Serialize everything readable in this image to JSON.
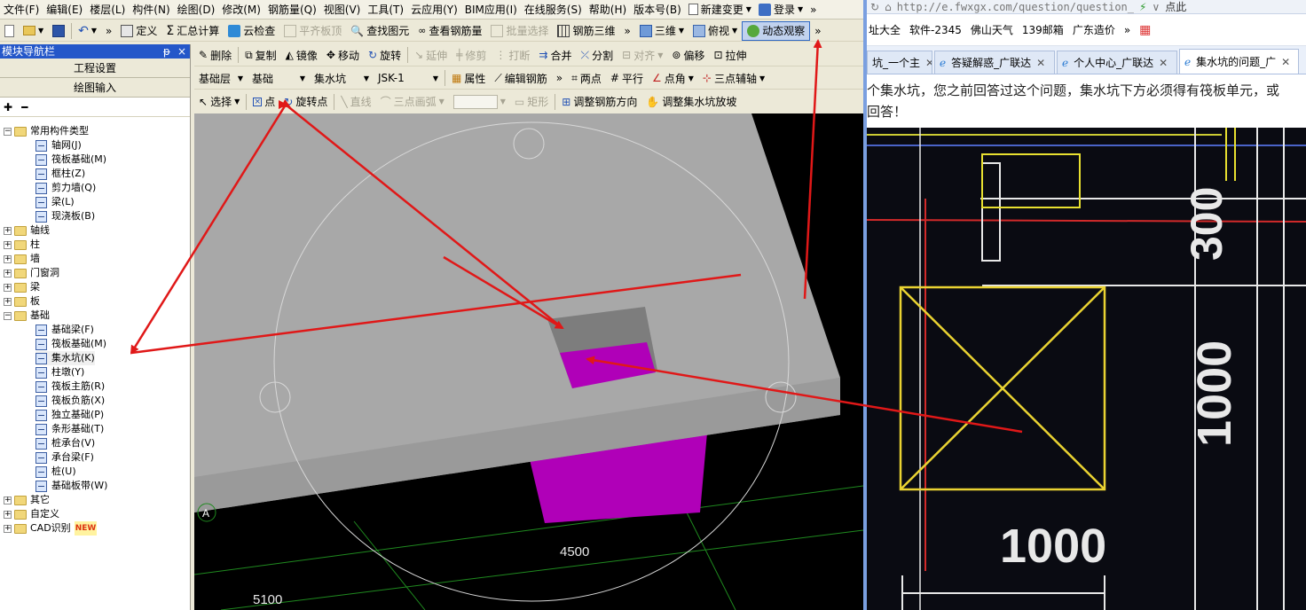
{
  "menu": {
    "items": [
      "文件(F)",
      "编辑(E)",
      "楼层(L)",
      "构件(N)",
      "绘图(D)",
      "修改(M)",
      "钢筋量(Q)",
      "视图(V)",
      "工具(T)",
      "云应用(Y)",
      "BIM应用(I)",
      "在线服务(S)",
      "帮助(H)",
      "版本号(B)"
    ],
    "new_change": "新建变更",
    "login": "登录"
  },
  "toolbar1": {
    "define": "定义",
    "sum": "汇总计算",
    "cloud_check": "云检查",
    "flat_top": "平齐板顶",
    "find": "查找图元",
    "view_rebar": "查看钢筋量",
    "batch_select": "批量选择",
    "rebar_3d": "钢筋三维",
    "view_3d": "三维",
    "top_view": "俯视",
    "dynamic": "动态观察"
  },
  "toolbar2": {
    "delete": "删除",
    "copy": "复制",
    "mirror": "镜像",
    "move": "移动",
    "rotate": "旋转",
    "extend": "延伸",
    "trim": "修剪",
    "break": "打断",
    "merge": "合并",
    "split": "分割",
    "align": "对齐",
    "offset": "偏移",
    "stretch": "拉伸"
  },
  "toolbar3": {
    "layer": "基础层",
    "category": "基础",
    "component_type": "集水坑",
    "component": "JSK-1",
    "property": "属性",
    "edit_rebar": "编辑钢筋",
    "two_points": "两点",
    "parallel": "平行",
    "point_angle": "点角",
    "three_point_aux": "三点辅轴"
  },
  "toolbar4": {
    "select": "选择",
    "point": "点",
    "rotate_point": "旋转点",
    "line": "直线",
    "three_point_arc": "三点画弧",
    "rect": "矩形",
    "adjust_rebar_dir": "调整钢筋方向",
    "adjust_pit_slope": "调整集水坑放坡"
  },
  "nav": {
    "title": "模块导航栏",
    "pin": "ᵽ",
    "close": "×",
    "project_settings": "工程设置",
    "draw_input": "绘图输入",
    "tree": [
      {
        "label": "常用构件类型",
        "type": "folder",
        "expanded": true
      },
      {
        "label": "轴网(J)",
        "type": "leaf"
      },
      {
        "label": "筏板基础(M)",
        "type": "leaf"
      },
      {
        "label": "框柱(Z)",
        "type": "leaf"
      },
      {
        "label": "剪力墙(Q)",
        "type": "leaf"
      },
      {
        "label": "梁(L)",
        "type": "leaf"
      },
      {
        "label": "现浇板(B)",
        "type": "leaf"
      },
      {
        "label": "轴线",
        "type": "folder"
      },
      {
        "label": "柱",
        "type": "folder"
      },
      {
        "label": "墙",
        "type": "folder"
      },
      {
        "label": "门窗洞",
        "type": "folder"
      },
      {
        "label": "梁",
        "type": "folder"
      },
      {
        "label": "板",
        "type": "folder"
      },
      {
        "label": "基础",
        "type": "folder",
        "expanded": true
      },
      {
        "label": "基础梁(F)",
        "type": "leaf"
      },
      {
        "label": "筏板基础(M)",
        "type": "leaf"
      },
      {
        "label": "集水坑(K)",
        "type": "leaf",
        "selected": true
      },
      {
        "label": "柱墩(Y)",
        "type": "leaf"
      },
      {
        "label": "筏板主筋(R)",
        "type": "leaf"
      },
      {
        "label": "筏板负筋(X)",
        "type": "leaf"
      },
      {
        "label": "独立基础(P)",
        "type": "leaf"
      },
      {
        "label": "条形基础(T)",
        "type": "leaf"
      },
      {
        "label": "桩承台(V)",
        "type": "leaf"
      },
      {
        "label": "承台梁(F)",
        "type": "leaf"
      },
      {
        "label": "桩(U)",
        "type": "leaf"
      },
      {
        "label": "基础板带(W)",
        "type": "leaf"
      },
      {
        "label": "其它",
        "type": "folder"
      },
      {
        "label": "自定义",
        "type": "folder"
      },
      {
        "label": "CAD识别",
        "type": "folder",
        "badge": "NEW"
      }
    ]
  },
  "viewport": {
    "dim_4500": "4500",
    "dim_5100": "5100",
    "axis_a": "A",
    "colors": {
      "slab": "#a8a8a8",
      "pit": "#b000b8",
      "grid": "#1f8a1f",
      "bg": "#000000"
    }
  },
  "browser": {
    "url": "http://e.fwxgx.com/question/question_",
    "right_text": "点此",
    "favorites": [
      "址大全",
      "软件-2345",
      "佛山天气",
      "139邮箱",
      "广东造价"
    ],
    "tabs": [
      {
        "label": "坑_一个主",
        "active": false
      },
      {
        "label": "答疑解惑_广联达",
        "active": false
      },
      {
        "label": "个人中心_广联达",
        "active": false
      },
      {
        "label": "集水坑的问题_广",
        "active": true
      }
    ],
    "question_line1": "个集水坑，您之前回答过这个问题，集水坑下方必须得有筏板单元，或",
    "question_line2": "回答！",
    "photo_dims": {
      "top": "300",
      "middle": "1000",
      "bottom": "1000"
    }
  },
  "annotations": {
    "arrow_color": "#e01818"
  }
}
